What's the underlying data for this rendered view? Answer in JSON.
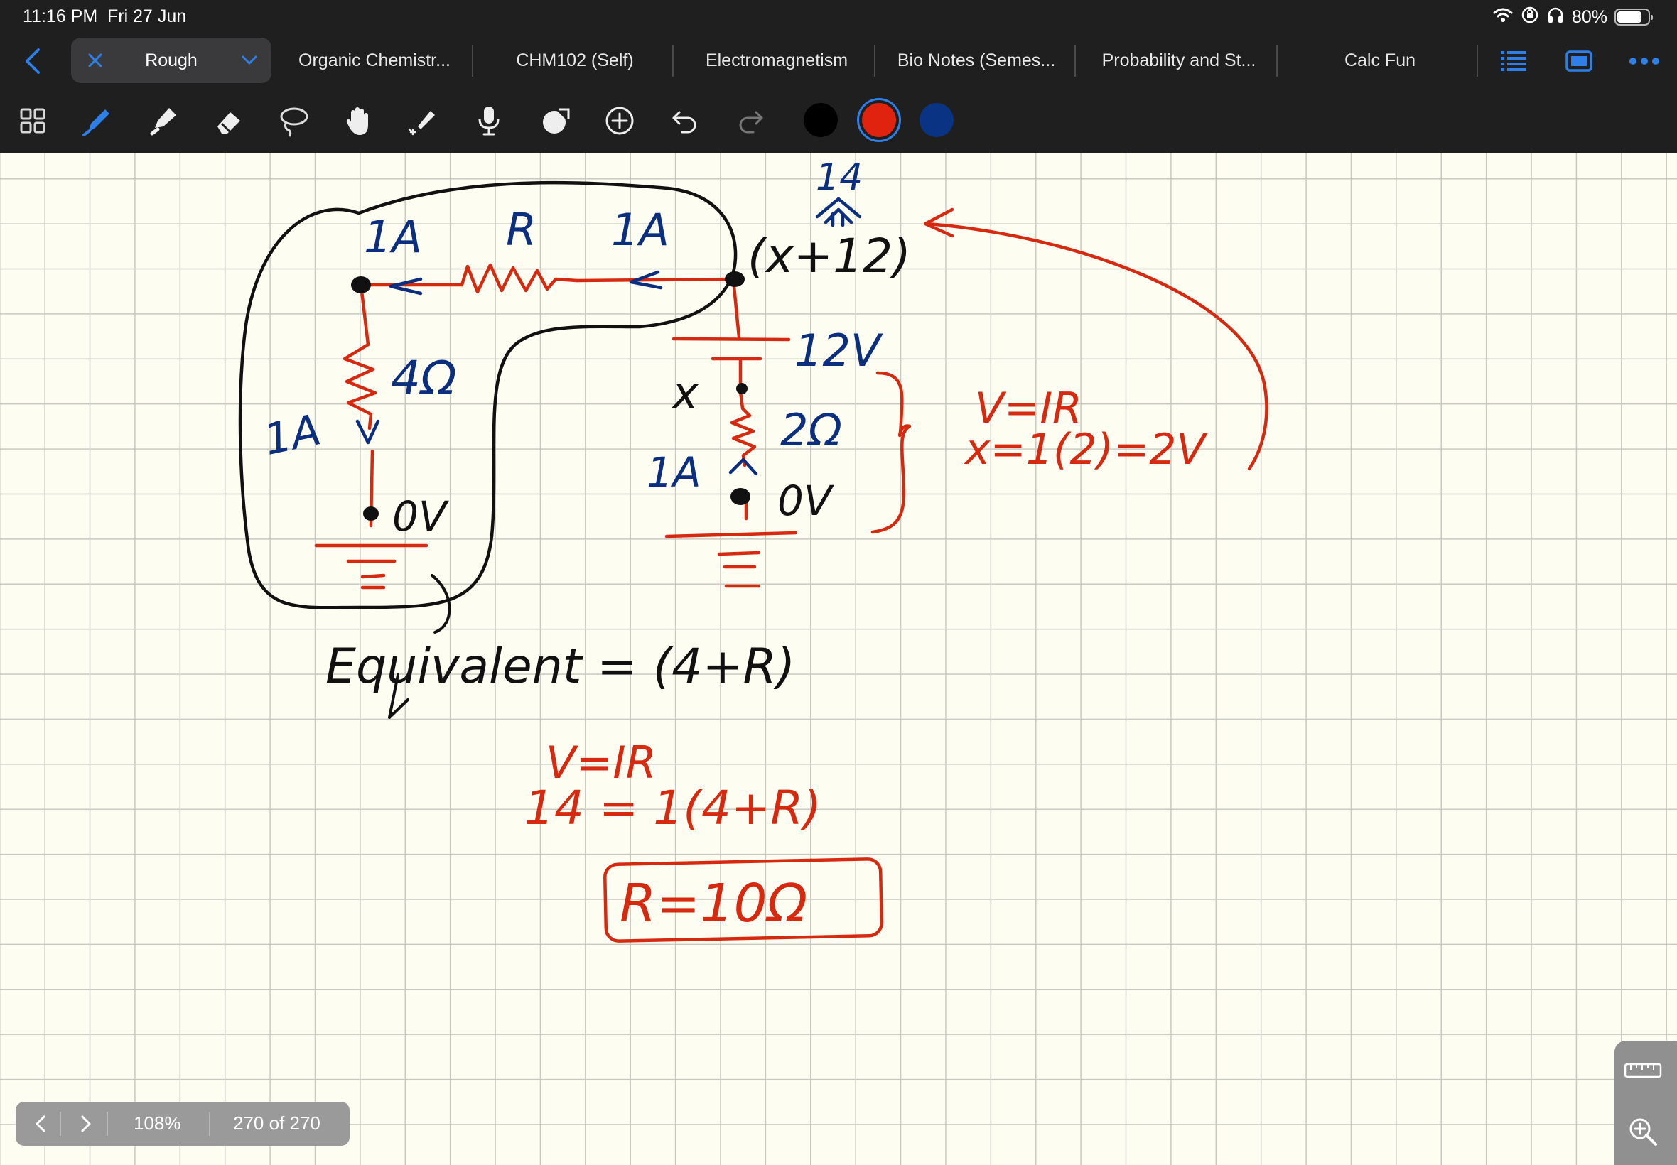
{
  "status_bar": {
    "time": "11:16 PM",
    "date": "Fri 27 Jun",
    "battery": "80%",
    "battery_level": 0.8,
    "icons": [
      "wifi-icon",
      "orientation-lock-icon",
      "headphones-icon",
      "battery-icon"
    ]
  },
  "tab_bar": {
    "active_tab": "Rough",
    "tabs": [
      "Organic Chemistr...",
      "CHM102 (Self)",
      "Electromagnetism",
      "Bio Notes (Semes...",
      "Probability and St...",
      "Calc Fun"
    ],
    "icons": [
      "back-chevron-icon",
      "close-icon",
      "chevron-down-icon",
      "outline-list-icon",
      "page-view-icon",
      "more-icon"
    ]
  },
  "toolbar": {
    "tools": [
      "thumbnails-icon",
      "pen-icon",
      "highlighter-icon",
      "eraser-icon",
      "lasso-icon",
      "hand-icon",
      "laser-pointer-icon",
      "microphone-icon",
      "shapes-icon",
      "add-icon",
      "undo-icon",
      "redo-icon"
    ],
    "colors": [
      "#000000",
      "#e0230f",
      "#0a3383"
    ],
    "selected_color": "#e0230f"
  },
  "canvas": {
    "paper_color": "#fefdf1",
    "grid_color": "#c9c9c3",
    "ink_blue": "#0b2f7e",
    "ink_red": "#d62a10",
    "ink_black": "#111111",
    "labels": {
      "current_top": "1A",
      "resistor_r": "R",
      "current_top_right": "1A",
      "fourteen": "14",
      "node_expr": "(x+12)",
      "four_ohm": "4Ω",
      "current_left": "1A",
      "zero_v_left": "0V",
      "battery_v": "12V",
      "x_label": "x",
      "two_ohm": "2Ω",
      "current_right": "1A",
      "zero_v_right": "0V",
      "ohms_law_right": "V=IR",
      "x_calc": "x=1(2)=2V",
      "equivalent": "Equivalent = (4+R)",
      "ohms_law_bottom": "V=IR",
      "calc_bottom": "14 = 1(4+R)",
      "answer": "R=10Ω"
    }
  },
  "page_nav": {
    "zoom": "108%",
    "page": "270 of 270"
  },
  "side_widget": {
    "icons": [
      "ruler-icon",
      "zoom-icon"
    ]
  }
}
